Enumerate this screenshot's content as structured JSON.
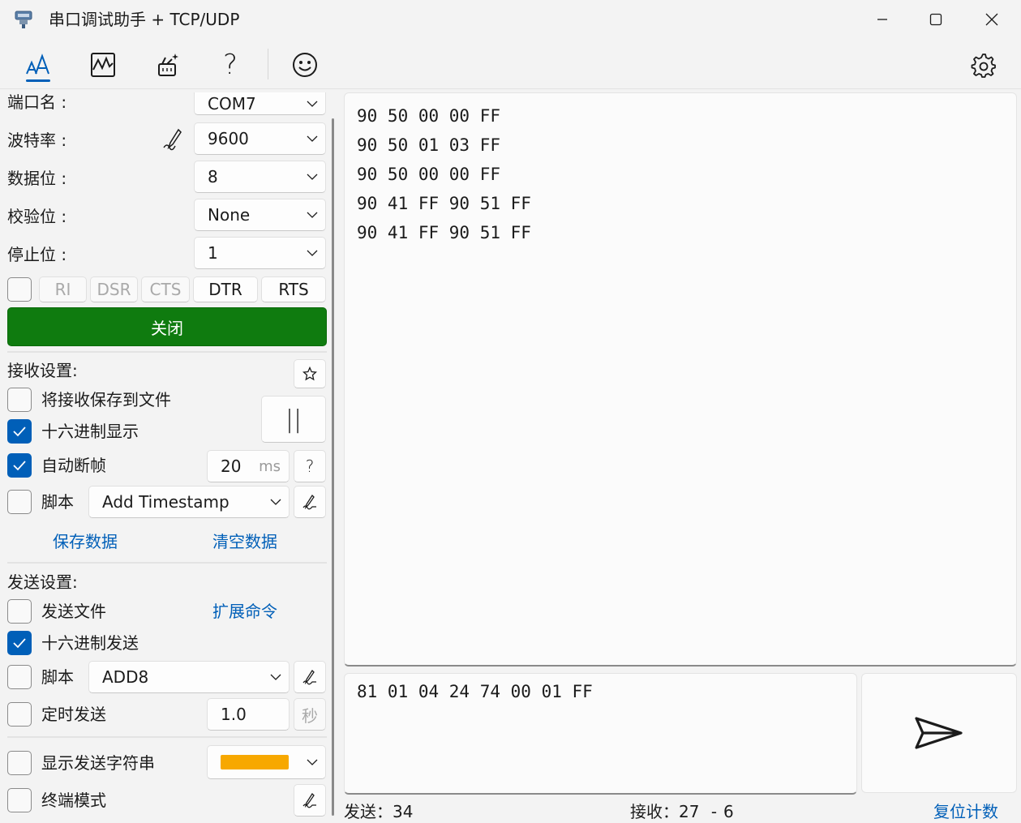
{
  "window": {
    "title": "串口调试助手 + TCP/UDP"
  },
  "toolbar": {
    "icons": [
      "font-style-icon",
      "waveform-chart-icon",
      "magic-tools-icon",
      "help-icon",
      "smiley-icon",
      "gear-icon"
    ],
    "help_glyph": "?"
  },
  "serial": {
    "port_label": "端口名 :",
    "port_value": "COM7",
    "baud_label": "波特率 :",
    "baud_value": "9600",
    "databits_label": "数据位 :",
    "databits_value": "8",
    "parity_label": "校验位 :",
    "parity_value": "None",
    "stopbits_label": "停止位 :",
    "stopbits_value": "1",
    "signals": [
      "RI",
      "DSR",
      "CTS",
      "DTR",
      "RTS"
    ],
    "close_label": "关闭"
  },
  "receive": {
    "header": "接收设置:",
    "save_to_file": "将接收保存到文件",
    "hex_display": "十六进制显示",
    "auto_frame": "自动断帧",
    "frame_ms_value": "20",
    "frame_ms_unit": "ms",
    "frame_help": "?",
    "script_label": "脚本",
    "script_value": "Add Timestamp",
    "pause_glyph": "||",
    "save_data": "保存数据",
    "clear_data": "清空数据"
  },
  "send": {
    "header": "发送设置:",
    "send_file": "发送文件",
    "ext_cmd": "扩展命令",
    "hex_send": "十六进制发送",
    "script_label": "脚本",
    "script_value": "ADD8",
    "timed_send": "定时发送",
    "timed_value": "1.0",
    "timed_unit": "秒",
    "show_send_str": "显示发送字符串",
    "send_color": "#f7a800",
    "terminal_mode": "终端模式"
  },
  "receive_log": [
    "90 50 00 00 FF",
    "90 50 01 03 FF",
    "90 50 00 00 FF",
    "90 41 FF 90 51 FF",
    "90 41 FF 90 51 FF"
  ],
  "send_input": "81 01 04 24 74 00 01 FF",
  "status": {
    "sent_label": "发送：",
    "sent_value": "34",
    "recv_label": "接收：",
    "recv_value": "27",
    "recv_sep": "-",
    "recv_frames": "6",
    "reset_counts": "复位计数"
  },
  "colors": {
    "accent": "#005fb8",
    "open_button": "#0f7b0f"
  }
}
